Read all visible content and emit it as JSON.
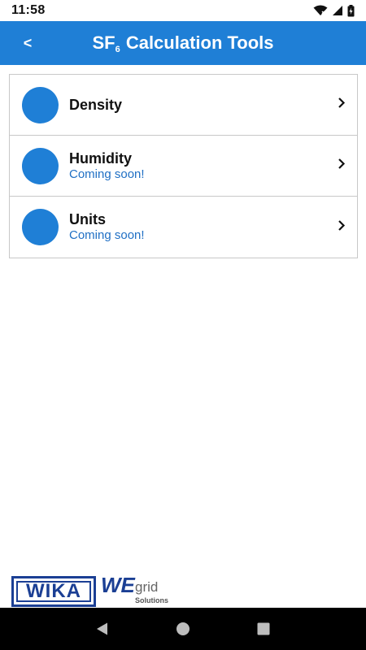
{
  "status_bar": {
    "time": "11:58",
    "icons": [
      "wifi-icon",
      "signal-icon",
      "battery-icon"
    ]
  },
  "app_bar": {
    "back_label": "<",
    "title_prefix": "SF",
    "title_subscript": "6",
    "title_suffix": " Calculation Tools",
    "color": "#1f7fd6"
  },
  "tools": [
    {
      "label": "Density",
      "subtitle": ""
    },
    {
      "label": "Humidity",
      "subtitle": "Coming soon!"
    },
    {
      "label": "Units",
      "subtitle": "Coming soon!"
    }
  ],
  "logos": {
    "wika": "WIKA",
    "wegrid_we": "WE",
    "wegrid_grid": "grid",
    "wegrid_solutions": "Solutions"
  },
  "nav_bar": {
    "buttons": [
      "back-nav-icon",
      "home-nav-icon",
      "recents-nav-icon"
    ]
  }
}
